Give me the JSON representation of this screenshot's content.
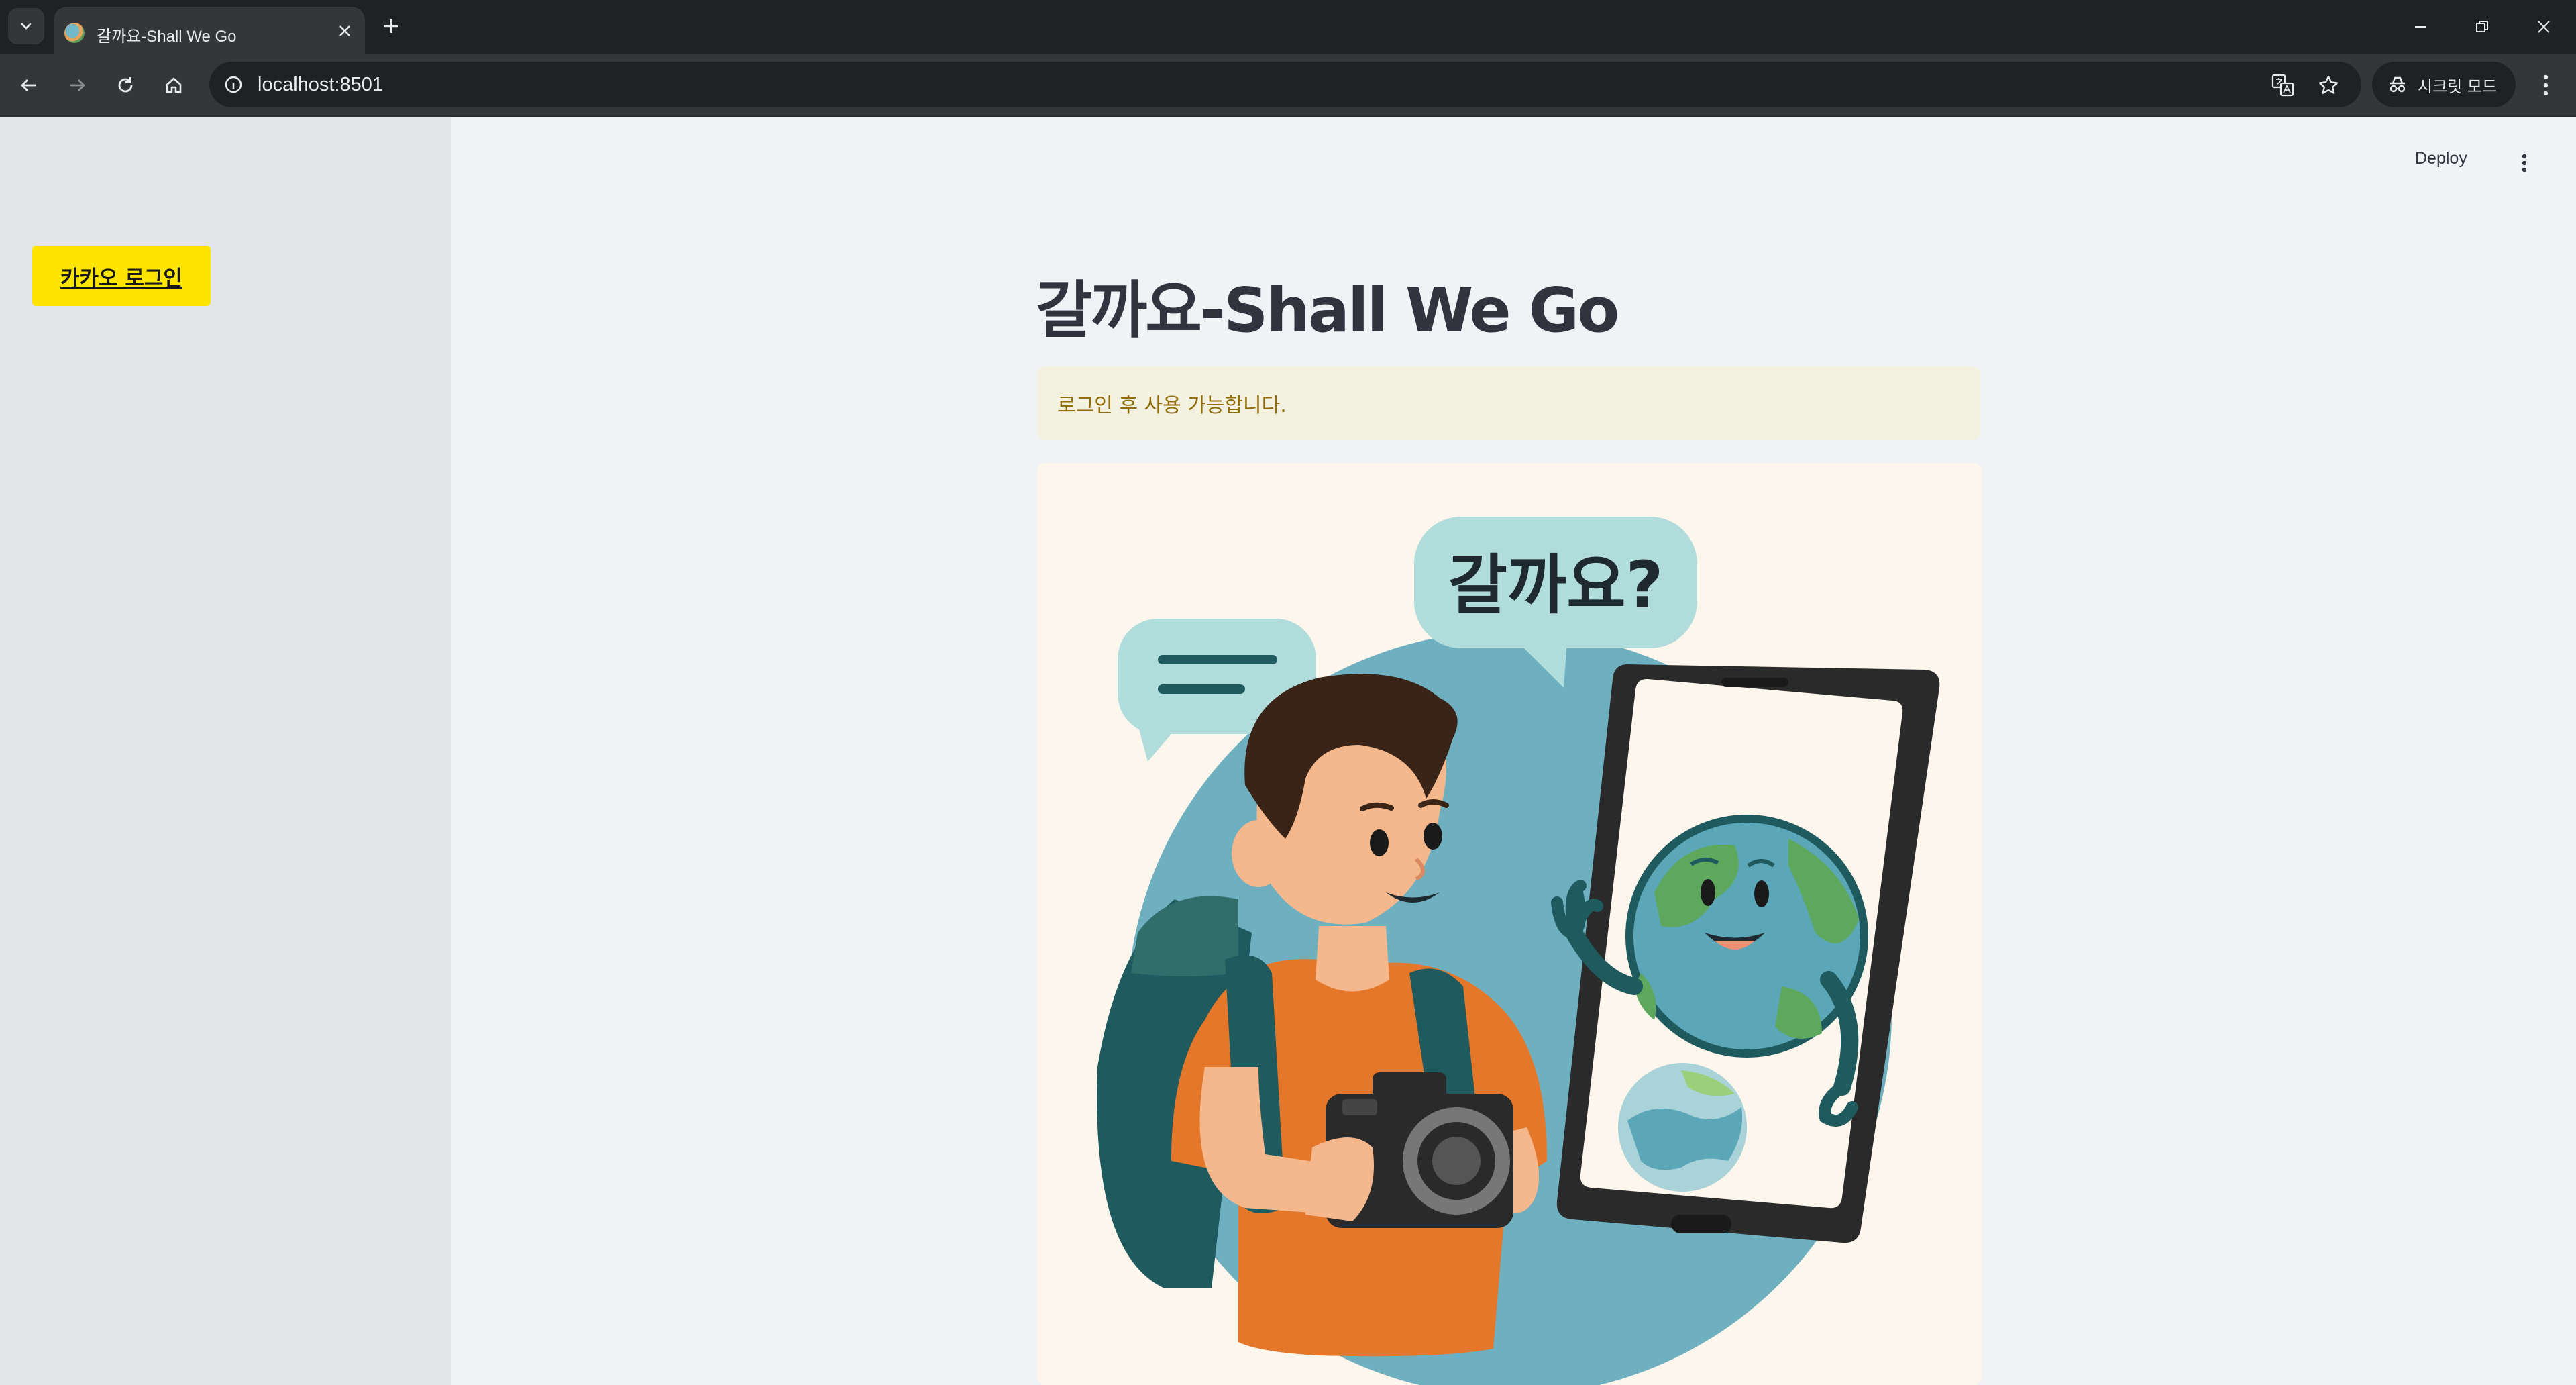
{
  "browser": {
    "tab_title": "갈까요-Shall We Go",
    "url": "localhost:8501",
    "incognito_label": "시크릿 모드"
  },
  "sidebar": {
    "login_button_label": "카카오 로그인"
  },
  "header": {
    "deploy_label": "Deploy"
  },
  "main": {
    "title": "갈까요-Shall We Go",
    "warning_text": "로그인 후 사용 가능합니다.",
    "illustration": {
      "speech_text": "갈까요?"
    }
  },
  "colors": {
    "kakao_yellow": "#fee500",
    "warning_bg": "#f3f1e0",
    "warning_text": "#926c05",
    "sidebar_bg": "#e2e4e8",
    "main_bg": "#f0f2f6"
  }
}
